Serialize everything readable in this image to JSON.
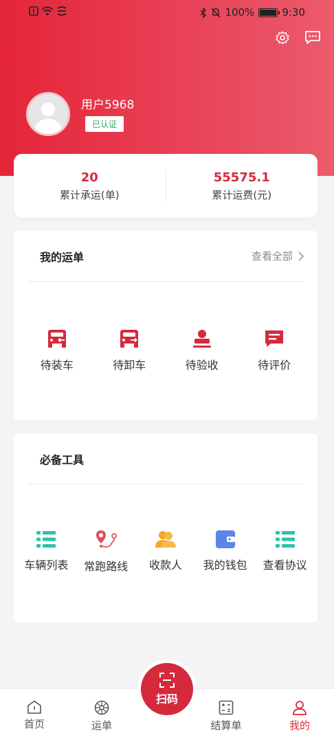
{
  "status_bar": {
    "battery": "100%",
    "time": "9:30"
  },
  "user": {
    "name": "用户5968",
    "badge": "已认证"
  },
  "stats": [
    {
      "value": "20",
      "label": "累计承运(单)"
    },
    {
      "value": "55575.1",
      "label": "累计运费(元)"
    }
  ],
  "orders": {
    "title": "我的运单",
    "view_all": "查看全部",
    "items": [
      {
        "label": "待装车",
        "icon": "truck-load-icon"
      },
      {
        "label": "待卸车",
        "icon": "truck-unload-icon"
      },
      {
        "label": "待验收",
        "icon": "stamp-icon"
      },
      {
        "label": "待评价",
        "icon": "comment-icon"
      }
    ]
  },
  "tools": {
    "title": "必备工具",
    "items": [
      {
        "label": "车辆列表",
        "icon": "list-icon"
      },
      {
        "label": "常跑路线",
        "icon": "route-icon"
      },
      {
        "label": "收款人",
        "icon": "payee-icon"
      },
      {
        "label": "我的钱包",
        "icon": "wallet-icon"
      },
      {
        "label": "查看协议",
        "icon": "list-icon"
      }
    ]
  },
  "bottom_nav": {
    "home": "首页",
    "waybill": "运单",
    "scan": "扫码",
    "settlement": "结算单",
    "mine": "我的"
  },
  "colors": {
    "brand_red": "#d42a3c",
    "teal": "#2bc5a8",
    "gold": "#f5a623",
    "blue": "#5b86e8"
  }
}
